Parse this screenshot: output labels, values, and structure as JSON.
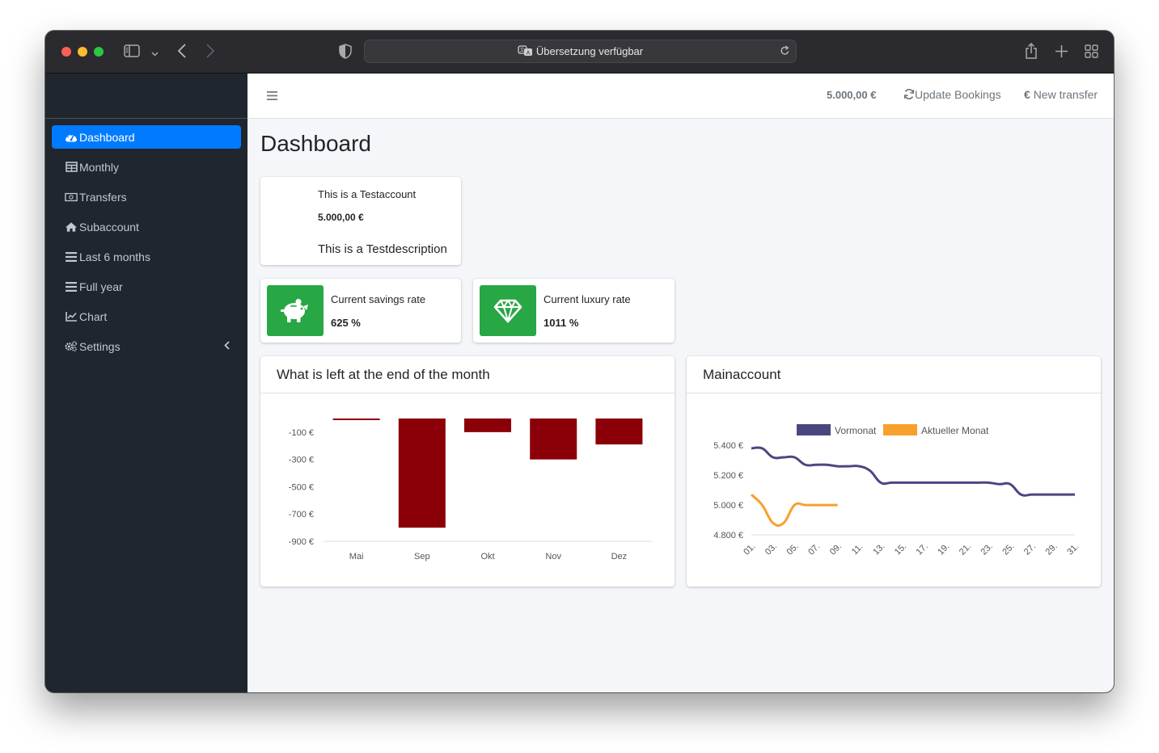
{
  "browser": {
    "url_text": "Übersetzung verfügbar"
  },
  "sidebar": {
    "items": [
      {
        "label": "Dashboard",
        "icon": "tachometer-icon",
        "active": true
      },
      {
        "label": "Monthly",
        "icon": "table-icon"
      },
      {
        "label": "Transfers",
        "icon": "money-bill-icon"
      },
      {
        "label": "Subaccount",
        "icon": "home-icon"
      },
      {
        "label": "Last 6 months",
        "icon": "bars-icon"
      },
      {
        "label": "Full year",
        "icon": "bars-icon"
      },
      {
        "label": "Chart",
        "icon": "line-chart-icon"
      },
      {
        "label": "Settings",
        "icon": "cogs-icon"
      }
    ]
  },
  "navbar": {
    "balance": "5.000,00 €",
    "update_bookings": "Update Bookings",
    "new_transfer": "New transfer"
  },
  "page": {
    "title": "Dashboard"
  },
  "account_card": {
    "name": "This is a Testaccount",
    "balance": "5.000,00 €",
    "description": "This is a Testdescription"
  },
  "savings_box": {
    "label": "Current savings rate",
    "value": "625 %",
    "icon": "piggy-bank-icon",
    "color": "#28a745"
  },
  "luxury_box": {
    "label": "Current luxury rate",
    "value": "1011 %",
    "icon": "gem-icon",
    "color": "#28a745"
  },
  "bar_card": {
    "title": "What is left at the end of the month"
  },
  "line_card": {
    "title": "Mainaccount"
  },
  "chart_data": [
    {
      "type": "bar",
      "categories": [
        "Mai",
        "Sep",
        "Okt",
        "Nov",
        "Dez"
      ],
      "values": [
        -10,
        -800,
        -100,
        -300,
        -190
      ],
      "yticks": [
        "-100 €",
        "-300 €",
        "-500 €",
        "-700 €",
        "-900 €"
      ],
      "ylim": [
        -900,
        0
      ],
      "color": "#8b0008",
      "grid": false
    },
    {
      "type": "line",
      "x": [
        "01.",
        "02.",
        "03.",
        "04.",
        "05.",
        "06.",
        "07.",
        "08.",
        "09.",
        "10.",
        "11.",
        "12.",
        "13.",
        "14.",
        "15.",
        "16.",
        "17.",
        "18.",
        "19.",
        "20.",
        "21.",
        "22.",
        "23.",
        "24.",
        "25.",
        "26.",
        "27.",
        "28.",
        "29.",
        "30.",
        "31."
      ],
      "xticks": [
        "01.",
        "03.",
        "05.",
        "07.",
        "09.",
        "11.",
        "13.",
        "15.",
        "17.",
        "19.",
        "21.",
        "23.",
        "25.",
        "27.",
        "29.",
        "31."
      ],
      "yticks": [
        "5.400 €",
        "5.200 €",
        "5.000 €",
        "4.800 €"
      ],
      "ylim": [
        4800,
        5450
      ],
      "legend_position": "top",
      "series": [
        {
          "name": "Vormonat",
          "color": "#4a4780",
          "values": [
            5380,
            5380,
            5320,
            5320,
            5320,
            5270,
            5270,
            5270,
            5260,
            5260,
            5260,
            5230,
            5150,
            5150,
            5150,
            5150,
            5150,
            5150,
            5150,
            5150,
            5150,
            5150,
            5150,
            5140,
            5140,
            5070,
            5070,
            5070,
            5070,
            5070,
            5070
          ]
        },
        {
          "name": "Aktueller Monat",
          "color": "#f7a02c",
          "values": [
            5070,
            5000,
            4880,
            4880,
            5000,
            5000,
            5000,
            5000,
            5000
          ]
        }
      ]
    }
  ]
}
